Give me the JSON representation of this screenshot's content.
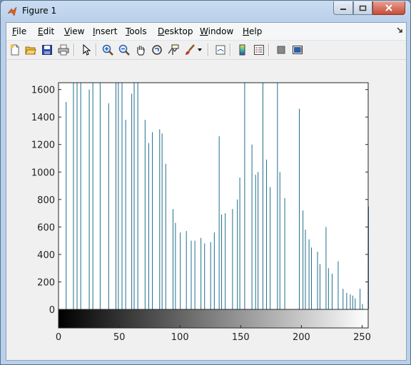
{
  "window": {
    "title": "Figure 1"
  },
  "menu": {
    "items": [
      {
        "label": "File",
        "u": "F",
        "rest": "ile"
      },
      {
        "label": "Edit",
        "u": "E",
        "rest": "dit"
      },
      {
        "label": "View",
        "u": "V",
        "rest": "iew"
      },
      {
        "label": "Insert",
        "u": "I",
        "rest": "nsert"
      },
      {
        "label": "Tools",
        "u": "T",
        "rest": "ools"
      },
      {
        "label": "Desktop",
        "u": "D",
        "rest": "esktop"
      },
      {
        "label": "Window",
        "u": "W",
        "rest": "indow"
      },
      {
        "label": "Help",
        "u": "H",
        "rest": "elp"
      }
    ]
  },
  "toolbar": {
    "icons": [
      "new-figure-icon",
      "open-file-icon",
      "save-icon",
      "print-icon",
      "edit-plot-icon",
      "zoom-in-icon",
      "zoom-out-icon",
      "pan-icon",
      "rotate-3d-icon",
      "data-cursor-icon",
      "brush-icon",
      "brush-dropdown-icon",
      "link-plot-icon",
      "insert-colorbar-icon",
      "insert-legend-icon",
      "hide-plot-tools-icon",
      "show-plot-tools-icon"
    ]
  },
  "chart_data": {
    "type": "bar",
    "title": "",
    "xlabel": "",
    "ylabel": "",
    "xlim": [
      0,
      255
    ],
    "ylim": [
      0,
      1650
    ],
    "xticks": [
      0,
      50,
      100,
      150,
      200,
      250
    ],
    "yticks": [
      0,
      200,
      400,
      600,
      800,
      1000,
      1200,
      1400,
      1600
    ],
    "bar_color": "#1f6e8c",
    "colorbar": "gray",
    "x": [
      6,
      12,
      15,
      18,
      25,
      28,
      34,
      41,
      47,
      49,
      52,
      55,
      60,
      62,
      65,
      71,
      74,
      77,
      83,
      85,
      88,
      94,
      96,
      100,
      105,
      109,
      112,
      117,
      120,
      125,
      128,
      132,
      134,
      137,
      143,
      147,
      149,
      153,
      159,
      162,
      164,
      168,
      171,
      174,
      180,
      182,
      186,
      198,
      201,
      203,
      206,
      208,
      213,
      215,
      220,
      222,
      225,
      230,
      234,
      237,
      240,
      242,
      244,
      248,
      250,
      255
    ],
    "values": [
      1510,
      1650,
      1650,
      1650,
      1600,
      1650,
      1650,
      1500,
      1650,
      1650,
      1650,
      1380,
      1570,
      1650,
      1650,
      1380,
      1210,
      1290,
      1310,
      1280,
      1060,
      730,
      630,
      560,
      570,
      500,
      500,
      520,
      480,
      490,
      560,
      1260,
      690,
      700,
      730,
      800,
      960,
      1650,
      1200,
      980,
      1000,
      1650,
      1090,
      890,
      1650,
      1000,
      810,
      1460,
      720,
      580,
      510,
      450,
      420,
      330,
      600,
      300,
      260,
      350,
      150,
      120,
      110,
      100,
      80,
      150,
      40,
      750
    ]
  }
}
